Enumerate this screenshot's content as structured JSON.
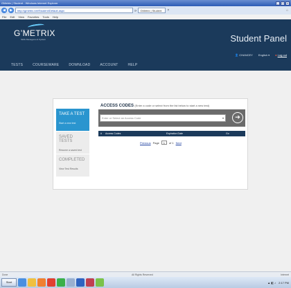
{
  "browser": {
    "title": "GMetrix | Student - Windows Internet Explorer",
    "url": "http://gmetrix.net/Student/Default.aspx",
    "tab_label": "GMetrix | Student",
    "menu": [
      "File",
      "Edit",
      "View",
      "Favorites",
      "Tools",
      "Help"
    ]
  },
  "header": {
    "logo": "G’METRIX",
    "logo_sub": "Skills Management System",
    "panel_title": "Student Panel",
    "user": "CHANCEY",
    "language": "English ▾",
    "logout": "Log out"
  },
  "nav": [
    "TESTS",
    "COURSEWARE",
    "DOWNLOAD",
    "ACCOUNT",
    "HELP"
  ],
  "access_codes": {
    "title": "ACCESS CODES",
    "subtitle": "Enter a code or select from the list below to start a new test",
    "placeholder": "Enter or Select an Access Code",
    "columns": [
      "#",
      "Access Codes",
      "Expiration Date",
      "Go"
    ]
  },
  "side_menu": [
    {
      "title": "TAKE A TEST",
      "sub": "Start a new test",
      "active": true
    },
    {
      "title": "SAVED TESTS",
      "sub": "Resume a saved test",
      "active": false
    },
    {
      "title": "COMPLETED",
      "sub": "View Test Results",
      "active": false
    }
  ],
  "pager": {
    "previous": "Previous",
    "page_label": "Page",
    "page": "1",
    "of": "of 1",
    "next": "Next"
  },
  "status": {
    "left": "Done",
    "middle": "All Rights Reserved",
    "right": "Internet"
  },
  "taskbar": {
    "start": "Start",
    "time": "2:17 PM"
  },
  "colors": {
    "header_bg": "#1b3a5b",
    "accent": "#2a95cf",
    "code_box": "#6b6b6b"
  }
}
